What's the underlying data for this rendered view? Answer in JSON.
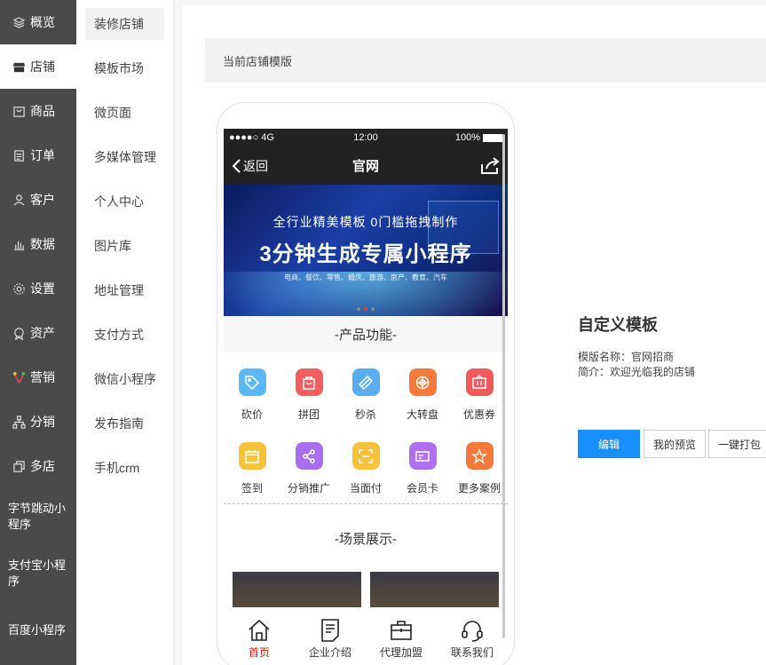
{
  "nav1": {
    "items": [
      {
        "label": "概览",
        "icon": "layers-icon"
      },
      {
        "label": "店铺",
        "icon": "store-icon"
      },
      {
        "label": "商品",
        "icon": "bag-icon"
      },
      {
        "label": "订单",
        "icon": "list-icon"
      },
      {
        "label": "客户",
        "icon": "user-icon"
      },
      {
        "label": "数据",
        "icon": "bar-chart-icon"
      },
      {
        "label": "设置",
        "icon": "gear-icon"
      },
      {
        "label": "资产",
        "icon": "medal-icon"
      },
      {
        "label": "营销",
        "icon": "marketing-icon"
      },
      {
        "label": "分销",
        "icon": "network-icon"
      },
      {
        "label": "多店",
        "icon": "multi-store-icon"
      },
      {
        "label": "字节跳动小程序"
      },
      {
        "label": "支付宝小程序"
      },
      {
        "label": "百度小程序"
      }
    ]
  },
  "nav2": {
    "items": [
      "装修店铺",
      "模板市场",
      "微页面",
      "多媒体管理",
      "个人中心",
      "图片库",
      "地址管理",
      "支付方式",
      "微信小程序",
      "发布指南",
      "手机crm"
    ]
  },
  "main": {
    "title": "当前店铺模版"
  },
  "phone": {
    "status": {
      "signal": "●●●●○ 4G",
      "time": "12:00",
      "battery": "100%"
    },
    "nav": {
      "back": "返回",
      "title": "官网"
    },
    "banner": {
      "line1": "全行业精美模板  0门槛拖拽制作",
      "line2": "3分钟生成专属小程序",
      "line3": "电商、餐饮、零售、婚庆、旅游、房产、教育、汽车"
    },
    "section1": "-产品功能-",
    "features": [
      {
        "label": "砍价",
        "color": "#5bb8f5",
        "icon": "tag-icon"
      },
      {
        "label": "拼团",
        "color": "#f06060",
        "icon": "bag-icon"
      },
      {
        "label": "秒杀",
        "color": "#5aaef0",
        "icon": "ticket-icon"
      },
      {
        "label": "大转盘",
        "color": "#f5793a",
        "icon": "wheel-icon"
      },
      {
        "label": "优惠券",
        "color": "#f05a5a",
        "icon": "coupon-icon"
      },
      {
        "label": "签到",
        "color": "#f8c13a",
        "icon": "calendar-icon"
      },
      {
        "label": "分销推广",
        "color": "#a86ef0",
        "icon": "share-icon"
      },
      {
        "label": "当面付",
        "color": "#f8c13a",
        "icon": "scan-icon"
      },
      {
        "label": "会员卡",
        "color": "#b06ef0",
        "icon": "card-icon"
      },
      {
        "label": "更多案例",
        "color": "#f5793a",
        "icon": "star-icon"
      }
    ],
    "section2": "-场景展示-",
    "tabs": [
      {
        "label": "首页",
        "icon": "home-icon"
      },
      {
        "label": "企业介绍",
        "icon": "document-icon"
      },
      {
        "label": "代理加盟",
        "icon": "briefcase-icon"
      },
      {
        "label": "联系我们",
        "icon": "headset-icon"
      }
    ]
  },
  "template": {
    "heading": "自定义模板",
    "name_line": "模版名称：官网招商",
    "desc_line": "简介：欢迎光临我的店铺",
    "edit": "编辑",
    "preview": "我的预览",
    "package": "一键打包"
  }
}
